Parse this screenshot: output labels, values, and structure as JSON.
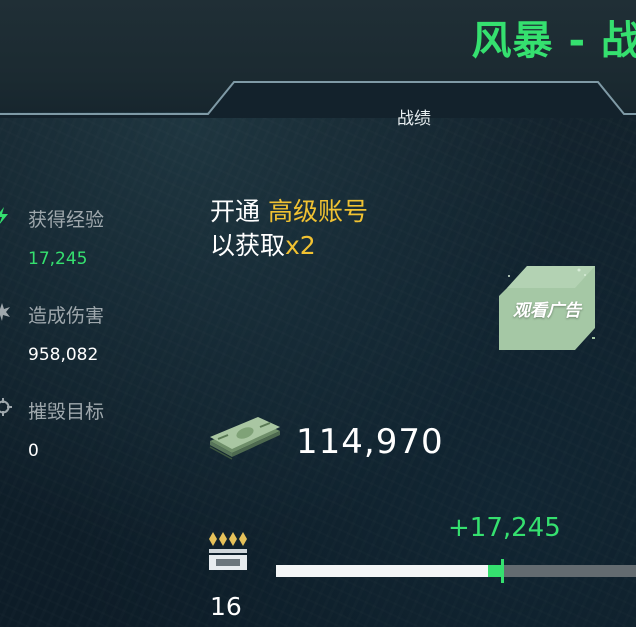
{
  "header": {
    "title": "风暴 - 战",
    "tab_label": "战绩"
  },
  "stats": [
    {
      "icon": "lightning-icon",
      "label": "获得经验",
      "value": "17,245"
    },
    {
      "icon": "explosion-icon",
      "label": "造成伤害",
      "value": "958,082"
    },
    {
      "icon": "crosshair-icon",
      "label": "摧毁目标",
      "value": "0"
    }
  ],
  "promo": {
    "line1_prefix": "开通",
    "line1_highlight": "高级账号",
    "line2_prefix": "以获取",
    "line2_highlight": "x2"
  },
  "ad_button": {
    "label": "观看广告"
  },
  "money": {
    "icon": "cash-stack-icon",
    "value": "114,970"
  },
  "rank": {
    "icon": "rank-insignia-icon",
    "level": "16"
  },
  "xp": {
    "gain_text": "+17,245",
    "progress_before": 0.59,
    "progress_after": 0.63
  },
  "colors": {
    "accent_green": "#35e06f",
    "highlight_yellow": "#f1c232",
    "label_gray": "#9fa8ad"
  }
}
